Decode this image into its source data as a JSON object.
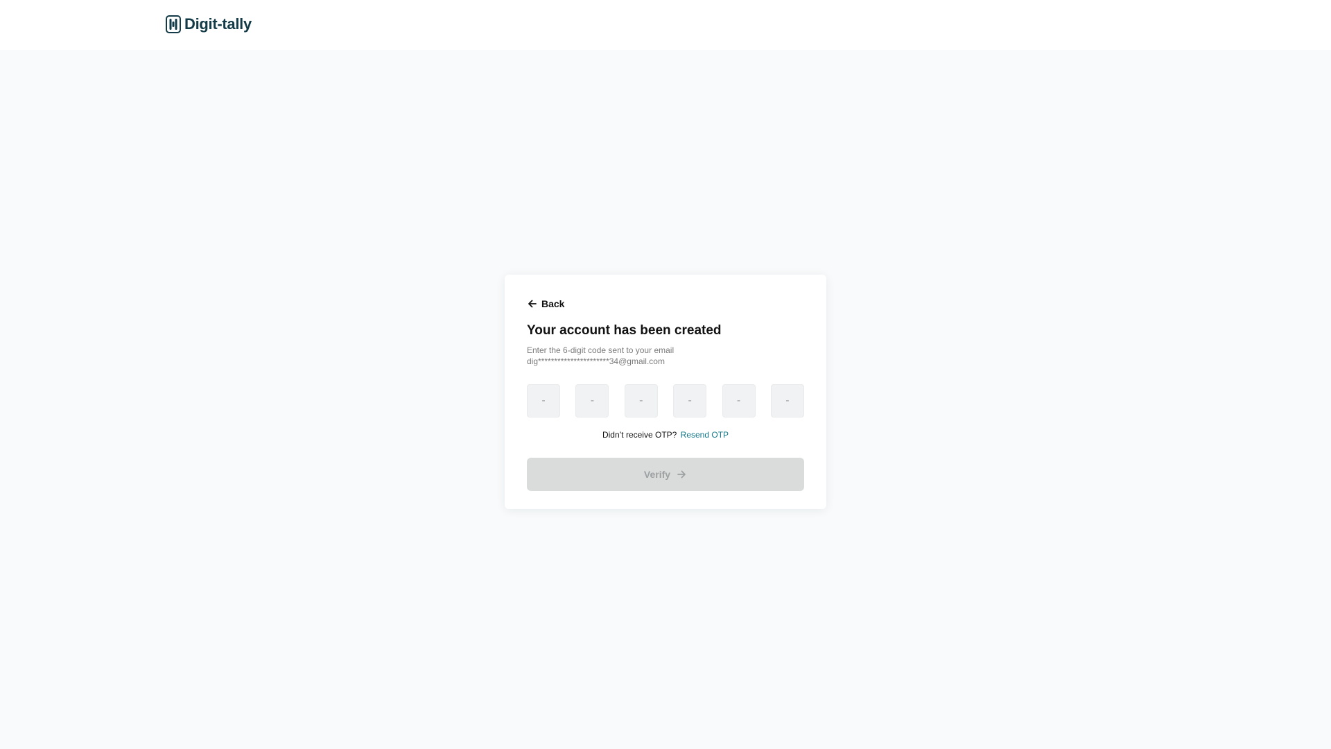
{
  "header": {
    "brand_name": "Digit-tally",
    "logo_icon": "digit-tally-logo-icon",
    "brand_color": "#123a47"
  },
  "card": {
    "back_label": "Back",
    "back_icon": "arrow-left-icon",
    "title": "Your account has been created",
    "subtitle_line1": "Enter the 6-digit code sent to your email",
    "subtitle_email": "dig**********************34@gmail.com",
    "otp_fields": [
      {
        "value": "",
        "placeholder": "-"
      },
      {
        "value": "",
        "placeholder": "-"
      },
      {
        "value": "",
        "placeholder": "-"
      },
      {
        "value": "",
        "placeholder": "-"
      },
      {
        "value": "",
        "placeholder": "-"
      },
      {
        "value": "",
        "placeholder": "-"
      }
    ],
    "resend_prompt": "Didn’t receive OTP?",
    "resend_link": "Resend OTP",
    "verify_label": "Verify",
    "verify_icon": "arrow-right-icon",
    "verify_disabled": true
  },
  "colors": {
    "page_background": "#f8fafb",
    "link": "#13788a",
    "button_disabled_bg": "#dadcdc",
    "button_disabled_text": "#9ea1a1"
  }
}
